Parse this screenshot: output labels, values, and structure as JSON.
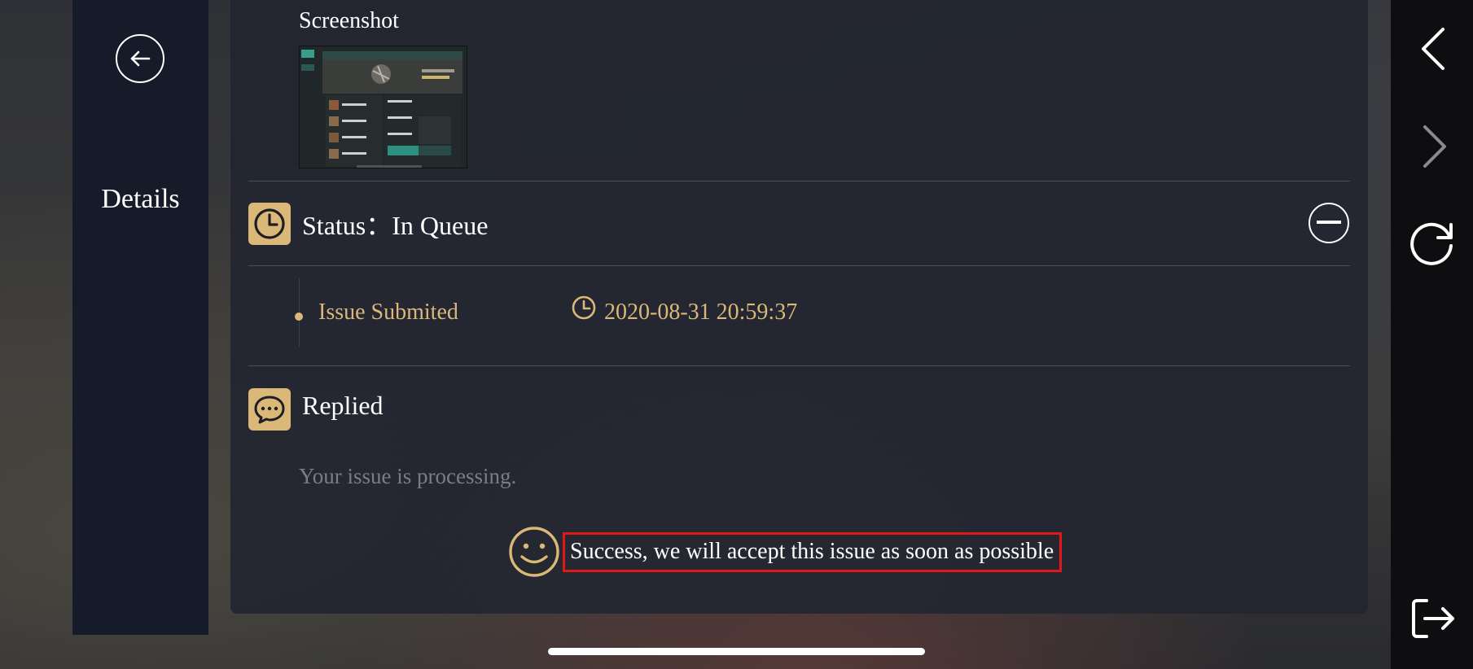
{
  "sidebar": {
    "back_icon": "arrow-left-circle-icon",
    "title": "Details"
  },
  "card": {
    "screenshot_label": "Screenshot",
    "status": {
      "icon": "clock-icon",
      "text": "Status：In Queue",
      "collapse_icon": "minus-circle-icon"
    },
    "timeline": [
      {
        "label": "Issue Submited",
        "time": "2020-08-31 20:59:37",
        "icon": "clock-icon"
      }
    ],
    "reply": {
      "icon": "chat-bubble-icon",
      "title": "Replied",
      "message": "Your issue is processing.",
      "success_icon": "smiley-icon",
      "success_message": "Success, we will accept this issue as soon as possible"
    }
  },
  "rail": {
    "back_icon": "chevron-left-icon",
    "forward_icon": "chevron-right-icon",
    "refresh_icon": "refresh-icon",
    "exit_icon": "exit-icon"
  },
  "colors": {
    "accent_gold": "#d9b878",
    "highlight_red": "#e01818",
    "panel": "#161b29"
  }
}
